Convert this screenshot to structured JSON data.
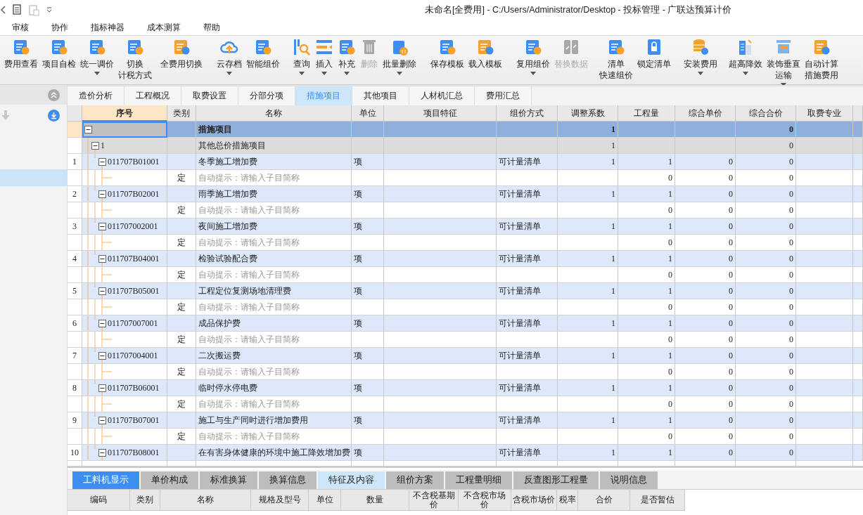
{
  "title_bar": {
    "title": "未命名[全费用] - C:/Users/Administrator/Desktop - 投标管理 - 广联达预算计价"
  },
  "menu": [
    "审核",
    "协作",
    "指标神器",
    "成本测算",
    "帮助"
  ],
  "toolbar": [
    {
      "lines": [
        "费用查看"
      ],
      "dropdown": false,
      "disabled": false
    },
    {
      "lines": [
        "项目自检"
      ],
      "dropdown": false,
      "disabled": false
    },
    {
      "lines": [
        "统一调价"
      ],
      "dropdown": true,
      "disabled": false
    },
    {
      "lines": [
        "切换",
        "计税方式"
      ],
      "dropdown": false,
      "disabled": false
    },
    {
      "lines": [
        "全费用切换"
      ],
      "dropdown": false,
      "disabled": false
    },
    {
      "lines": [
        "云存档"
      ],
      "dropdown": true,
      "disabled": false
    },
    {
      "lines": [
        "智能组价"
      ],
      "dropdown": false,
      "disabled": false
    },
    {
      "lines": [
        "查询"
      ],
      "dropdown": true,
      "disabled": false
    },
    {
      "lines": [
        "插入"
      ],
      "dropdown": true,
      "disabled": false
    },
    {
      "lines": [
        "补充"
      ],
      "dropdown": true,
      "disabled": false
    },
    {
      "lines": [
        "删除"
      ],
      "dropdown": false,
      "disabled": true
    },
    {
      "lines": [
        "批量删除"
      ],
      "dropdown": true,
      "disabled": false
    },
    {
      "lines": [
        "保存模板"
      ],
      "dropdown": false,
      "disabled": false
    },
    {
      "lines": [
        "载入模板"
      ],
      "dropdown": false,
      "disabled": false
    },
    {
      "lines": [
        "复用组价"
      ],
      "dropdown": true,
      "disabled": false
    },
    {
      "lines": [
        "替换数据"
      ],
      "dropdown": false,
      "disabled": true
    },
    {
      "lines": [
        "清单",
        "快速组价"
      ],
      "dropdown": false,
      "disabled": false
    },
    {
      "lines": [
        "锁定清单"
      ],
      "dropdown": false,
      "disabled": false
    },
    {
      "lines": [
        "安装费用"
      ],
      "dropdown": true,
      "disabled": false
    },
    {
      "lines": [
        "超高降效"
      ],
      "dropdown": true,
      "disabled": false
    },
    {
      "lines": [
        "装饰垂直",
        "运输"
      ],
      "dropdown": true,
      "disabled": false
    },
    {
      "lines": [
        "自动计算",
        "措施费用"
      ],
      "dropdown": false,
      "disabled": false
    }
  ],
  "tabs": [
    {
      "label": "造价分析",
      "selected": false
    },
    {
      "label": "工程概况",
      "selected": false
    },
    {
      "label": "取费设置",
      "selected": false
    },
    {
      "label": "分部分项",
      "selected": false
    },
    {
      "label": "措施项目",
      "selected": true
    },
    {
      "label": "其他项目",
      "selected": false
    },
    {
      "label": "人材机汇总",
      "selected": false
    },
    {
      "label": "费用汇总",
      "selected": false
    }
  ],
  "grid": {
    "columns": [
      "序号",
      "类别",
      "名称",
      "单位",
      "项目特征",
      "组价方式",
      "调整系数",
      "工程量",
      "综合单价",
      "综合合价",
      "取费专业"
    ],
    "rows": [
      {
        "selected": true,
        "expanded": true,
        "name": "措施项目",
        "coef": "1",
        "total": "0",
        "children": [
          {
            "selected": false,
            "expanded": true,
            "code": "1",
            "name": "其他总价措施项目",
            "coef": "1",
            "total": "0",
            "children": [
              {
                "selected": false,
                "expanded": true,
                "num": "1",
                "code": "011707B01001",
                "name": "冬季施工增加费",
                "unit": "项",
                "method": "可计量清单",
                "coef": "1",
                "qty": "1",
                "price": "0",
                "total": "0",
                "children": [
                  {
                    "selected": false,
                    "type": "定",
                    "placeholder": "自动提示：请输入子目简称",
                    "qty": "0",
                    "price": "0",
                    "total": "0"
                  }
                ]
              },
              {
                "selected": false,
                "expanded": true,
                "num": "2",
                "code": "011707B02001",
                "name": "雨季施工增加费",
                "unit": "项",
                "method": "可计量清单",
                "coef": "1",
                "qty": "1",
                "price": "0",
                "total": "0",
                "children": [
                  {
                    "selected": false,
                    "type": "定",
                    "placeholder": "自动提示：请输入子目简称",
                    "qty": "0",
                    "price": "0",
                    "total": "0"
                  }
                ]
              },
              {
                "selected": false,
                "expanded": true,
                "num": "3",
                "code": "011707002001",
                "name": "夜间施工增加费",
                "unit": "项",
                "method": "可计量清单",
                "coef": "1",
                "qty": "1",
                "price": "0",
                "total": "0",
                "children": [
                  {
                    "selected": false,
                    "type": "定",
                    "placeholder": "自动提示：请输入子目简称",
                    "qty": "0",
                    "price": "0",
                    "total": "0"
                  }
                ]
              },
              {
                "selected": false,
                "expanded": true,
                "num": "4",
                "code": "011707B04001",
                "name": "检验试验配合费",
                "unit": "项",
                "method": "可计量清单",
                "coef": "1",
                "qty": "1",
                "price": "0",
                "total": "0",
                "children": [
                  {
                    "selected": false,
                    "type": "定",
                    "placeholder": "自动提示：请输入子目简称",
                    "qty": "0",
                    "price": "0",
                    "total": "0"
                  }
                ]
              },
              {
                "selected": false,
                "expanded": true,
                "num": "5",
                "code": "011707B05001",
                "name": "工程定位复测场地清理费",
                "unit": "项",
                "method": "可计量清单",
                "coef": "1",
                "qty": "1",
                "price": "0",
                "total": "0",
                "children": [
                  {
                    "selected": false,
                    "type": "定",
                    "placeholder": "自动提示：请输入子目简称",
                    "qty": "0",
                    "price": "0",
                    "total": "0"
                  }
                ]
              },
              {
                "selected": false,
                "expanded": true,
                "num": "6",
                "code": "011707007001",
                "name": "成品保护费",
                "unit": "项",
                "method": "可计量清单",
                "coef": "1",
                "qty": "1",
                "price": "0",
                "total": "0",
                "children": [
                  {
                    "selected": false,
                    "type": "定",
                    "placeholder": "自动提示：请输入子目简称",
                    "qty": "0",
                    "price": "0",
                    "total": "0"
                  }
                ]
              },
              {
                "selected": false,
                "expanded": true,
                "num": "7",
                "code": "011707004001",
                "name": "二次搬运费",
                "unit": "项",
                "method": "可计量清单",
                "coef": "1",
                "qty": "1",
                "price": "0",
                "total": "0",
                "children": [
                  {
                    "selected": false,
                    "type": "定",
                    "placeholder": "自动提示：请输入子目简称",
                    "qty": "0",
                    "price": "0",
                    "total": "0"
                  }
                ]
              },
              {
                "selected": false,
                "expanded": true,
                "num": "8",
                "code": "011707B06001",
                "name": "临时停水停电费",
                "unit": "项",
                "method": "可计量清单",
                "coef": "1",
                "qty": "1",
                "price": "0",
                "total": "0",
                "children": [
                  {
                    "selected": false,
                    "type": "定",
                    "placeholder": "自动提示：请输入子目简称",
                    "qty": "0",
                    "price": "0",
                    "total": "0"
                  }
                ]
              },
              {
                "selected": false,
                "expanded": true,
                "num": "9",
                "code": "011707B07001",
                "name": "施工与生产同时进行增加费用",
                "unit": "项",
                "method": "可计量清单",
                "coef": "1",
                "qty": "1",
                "price": "0",
                "total": "0",
                "children": [
                  {
                    "selected": false,
                    "type": "定",
                    "placeholder": "自动提示：请输入子目简称",
                    "qty": "0",
                    "price": "0",
                    "total": "0"
                  }
                ]
              },
              {
                "selected": false,
                "expanded": true,
                "num": "10",
                "code": "011707B08001",
                "name": "在有害身体健康的环境中施工降效增加费",
                "unit": "项",
                "method": "可计量清单",
                "coef": "1",
                "qty": "1",
                "price": "0",
                "total": "0"
              }
            ]
          }
        ]
      }
    ]
  },
  "bottom_tabs": [
    {
      "label": "工料机显示",
      "selected": true,
      "highlighted": false
    },
    {
      "label": "单价构成",
      "selected": false,
      "highlighted": false
    },
    {
      "label": "标准换算",
      "selected": false,
      "highlighted": false
    },
    {
      "label": "换算信息",
      "selected": false,
      "highlighted": false
    },
    {
      "label": "特征及内容",
      "selected": false,
      "highlighted": true
    },
    {
      "label": "组价方案",
      "selected": false,
      "highlighted": false
    },
    {
      "label": "工程量明细",
      "selected": false,
      "highlighted": false
    },
    {
      "label": "反查图形工程量",
      "selected": false,
      "highlighted": false
    },
    {
      "label": "说明信息",
      "selected": false,
      "highlighted": false
    }
  ],
  "bottom_columns": [
    "编码",
    "类别",
    "名称",
    "规格及型号",
    "单位",
    "数量",
    "不含税基期价",
    "不含税市场价",
    "含税市场价",
    "税率",
    "合价",
    "是否暂估"
  ]
}
